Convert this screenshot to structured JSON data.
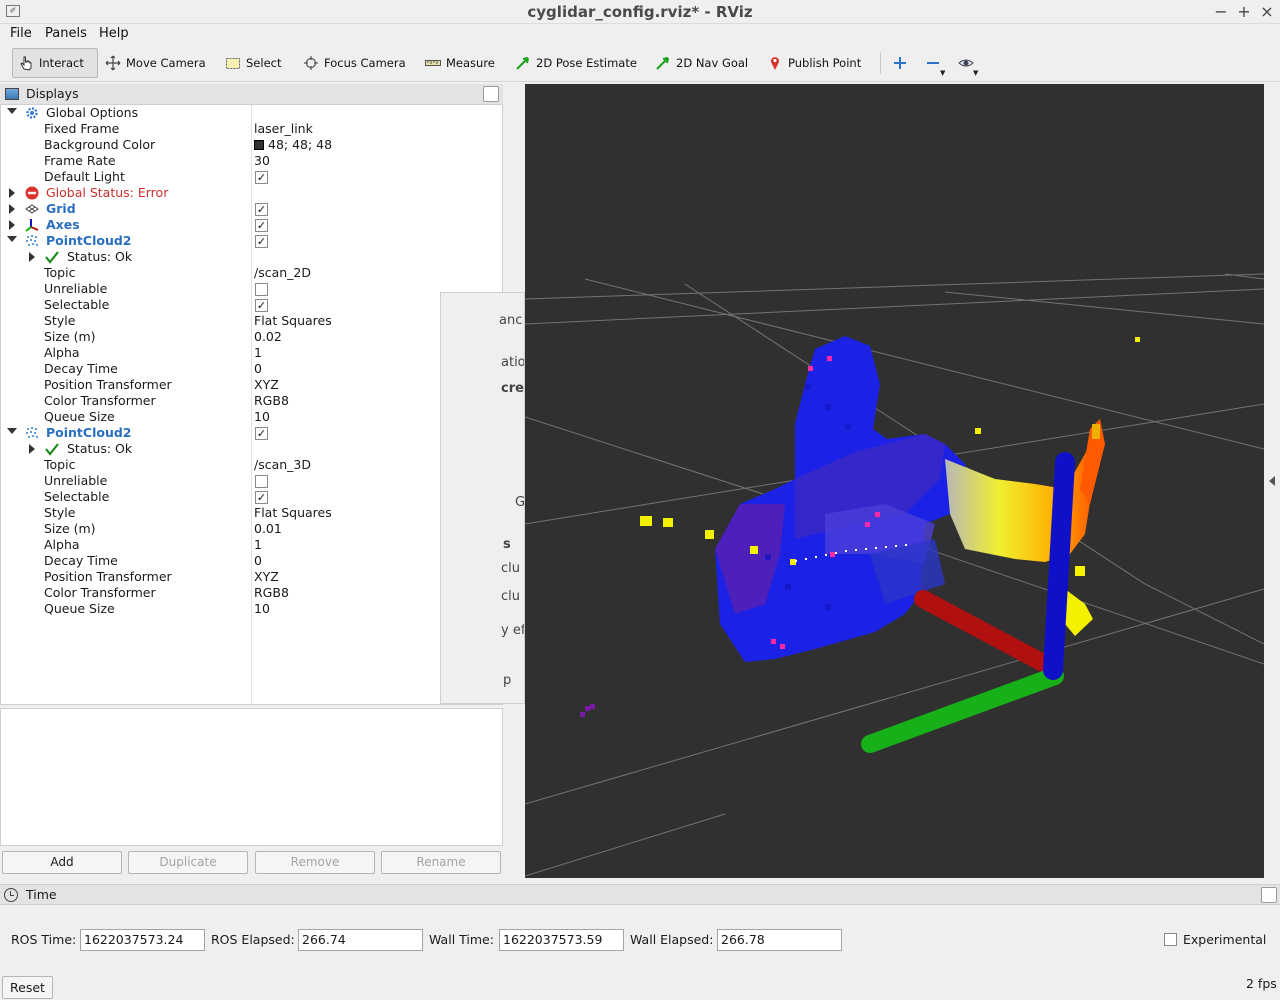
{
  "window": {
    "title": "cyglidar_config.rviz* - RViz"
  },
  "menu": [
    "File",
    "Panels",
    "Help"
  ],
  "toolbar": {
    "tools": [
      {
        "label": "Interact",
        "icon": "hand-pointer-icon",
        "active": true
      },
      {
        "label": "Move Camera",
        "icon": "move-arrows-icon"
      },
      {
        "label": "Select",
        "icon": "select-rect-icon"
      },
      {
        "label": "Focus Camera",
        "icon": "crosshair-icon"
      },
      {
        "label": "Measure",
        "icon": "ruler-icon"
      },
      {
        "label": "2D Pose Estimate",
        "icon": "green-arrow-icon"
      },
      {
        "label": "2D Nav Goal",
        "icon": "green-arrow-icon"
      },
      {
        "label": "Publish Point",
        "icon": "map-pin-icon"
      }
    ],
    "icons": [
      "plus-icon",
      "minus-icon",
      "eye-icon"
    ]
  },
  "displays": {
    "title": "Displays",
    "global_options": {
      "label": "Global Options",
      "fixed_frame_label": "Fixed Frame",
      "fixed_frame": "laser_link",
      "bg_color_label": "Background Color",
      "bg_color": "48; 48; 48",
      "bg_color_hex": "#303030",
      "frame_rate_label": "Frame Rate",
      "frame_rate": "30",
      "default_light_label": "Default Light",
      "default_light": true
    },
    "global_status": {
      "label": "Global Status: Error"
    },
    "grid": {
      "label": "Grid",
      "enabled": true
    },
    "axes": {
      "label": "Axes",
      "enabled": true
    },
    "pointclouds": [
      {
        "label": "PointCloud2",
        "enabled": true,
        "status": "Status: Ok",
        "topic_label": "Topic",
        "topic": "/scan_2D",
        "unreliable_label": "Unreliable",
        "unreliable": false,
        "selectable_label": "Selectable",
        "selectable": true,
        "style_label": "Style",
        "style": "Flat Squares",
        "size_label": "Size (m)",
        "size": "0.02",
        "alpha_label": "Alpha",
        "alpha": "1",
        "decay_label": "Decay Time",
        "decay": "0",
        "pos_tf_label": "Position Transformer",
        "pos_tf": "XYZ",
        "color_tf_label": "Color Transformer",
        "color_tf": "RGB8",
        "queue_label": "Queue Size",
        "queue": "10"
      },
      {
        "label": "PointCloud2",
        "enabled": true,
        "status": "Status: Ok",
        "topic_label": "Topic",
        "topic": "/scan_3D",
        "unreliable_label": "Unreliable",
        "unreliable": false,
        "selectable_label": "Selectable",
        "selectable": true,
        "style_label": "Style",
        "style": "Flat Squares",
        "size_label": "Size (m)",
        "size": "0.01",
        "alpha_label": "Alpha",
        "alpha": "1",
        "decay_label": "Decay Time",
        "decay": "0",
        "pos_tf_label": "Position Transformer",
        "pos_tf": "XYZ",
        "color_tf_label": "Color Transformer",
        "color_tf": "RGB8",
        "queue_label": "Queue Size",
        "queue": "10"
      }
    ],
    "buttons": {
      "add": "Add",
      "duplicate": "Duplicate",
      "remove": "Remove",
      "rename": "Rename"
    }
  },
  "time": {
    "title": "Time",
    "ros_time_label": "ROS Time:",
    "ros_time": "1622037573.24",
    "ros_elapsed_label": "ROS Elapsed:",
    "ros_elapsed": "266.74",
    "wall_time_label": "Wall Time:",
    "wall_time": "1622037573.59",
    "wall_elapsed_label": "Wall Elapsed:",
    "wall_elapsed": "266.78",
    "experimental_label": "Experimental",
    "reset": "Reset",
    "fps": "2 fps"
  },
  "ghost_text": [
    "anc",
    "atio",
    "cre",
    "G",
    "s",
    "clu",
    "clu",
    "y eff",
    "p"
  ],
  "colors": {
    "axis_x": "#b01010",
    "axis_y": "#18b018",
    "axis_z": "#1010c8",
    "error": "#c9302c",
    "link_blue": "#2a6fc0"
  }
}
